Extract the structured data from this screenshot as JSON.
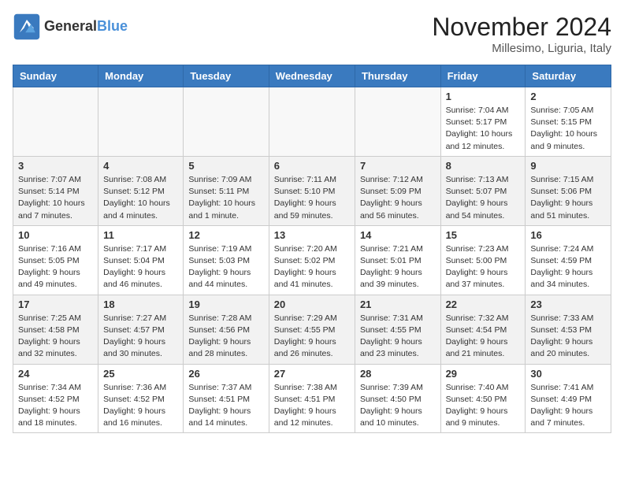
{
  "header": {
    "logo_line1": "General",
    "logo_line2": "Blue",
    "month": "November 2024",
    "location": "Millesimo, Liguria, Italy"
  },
  "weekdays": [
    "Sunday",
    "Monday",
    "Tuesday",
    "Wednesday",
    "Thursday",
    "Friday",
    "Saturday"
  ],
  "weeks": [
    [
      {
        "day": "",
        "info": ""
      },
      {
        "day": "",
        "info": ""
      },
      {
        "day": "",
        "info": ""
      },
      {
        "day": "",
        "info": ""
      },
      {
        "day": "",
        "info": ""
      },
      {
        "day": "1",
        "info": "Sunrise: 7:04 AM\nSunset: 5:17 PM\nDaylight: 10 hours\nand 12 minutes."
      },
      {
        "day": "2",
        "info": "Sunrise: 7:05 AM\nSunset: 5:15 PM\nDaylight: 10 hours\nand 9 minutes."
      }
    ],
    [
      {
        "day": "3",
        "info": "Sunrise: 7:07 AM\nSunset: 5:14 PM\nDaylight: 10 hours\nand 7 minutes."
      },
      {
        "day": "4",
        "info": "Sunrise: 7:08 AM\nSunset: 5:12 PM\nDaylight: 10 hours\nand 4 minutes."
      },
      {
        "day": "5",
        "info": "Sunrise: 7:09 AM\nSunset: 5:11 PM\nDaylight: 10 hours\nand 1 minute."
      },
      {
        "day": "6",
        "info": "Sunrise: 7:11 AM\nSunset: 5:10 PM\nDaylight: 9 hours\nand 59 minutes."
      },
      {
        "day": "7",
        "info": "Sunrise: 7:12 AM\nSunset: 5:09 PM\nDaylight: 9 hours\nand 56 minutes."
      },
      {
        "day": "8",
        "info": "Sunrise: 7:13 AM\nSunset: 5:07 PM\nDaylight: 9 hours\nand 54 minutes."
      },
      {
        "day": "9",
        "info": "Sunrise: 7:15 AM\nSunset: 5:06 PM\nDaylight: 9 hours\nand 51 minutes."
      }
    ],
    [
      {
        "day": "10",
        "info": "Sunrise: 7:16 AM\nSunset: 5:05 PM\nDaylight: 9 hours\nand 49 minutes."
      },
      {
        "day": "11",
        "info": "Sunrise: 7:17 AM\nSunset: 5:04 PM\nDaylight: 9 hours\nand 46 minutes."
      },
      {
        "day": "12",
        "info": "Sunrise: 7:19 AM\nSunset: 5:03 PM\nDaylight: 9 hours\nand 44 minutes."
      },
      {
        "day": "13",
        "info": "Sunrise: 7:20 AM\nSunset: 5:02 PM\nDaylight: 9 hours\nand 41 minutes."
      },
      {
        "day": "14",
        "info": "Sunrise: 7:21 AM\nSunset: 5:01 PM\nDaylight: 9 hours\nand 39 minutes."
      },
      {
        "day": "15",
        "info": "Sunrise: 7:23 AM\nSunset: 5:00 PM\nDaylight: 9 hours\nand 37 minutes."
      },
      {
        "day": "16",
        "info": "Sunrise: 7:24 AM\nSunset: 4:59 PM\nDaylight: 9 hours\nand 34 minutes."
      }
    ],
    [
      {
        "day": "17",
        "info": "Sunrise: 7:25 AM\nSunset: 4:58 PM\nDaylight: 9 hours\nand 32 minutes."
      },
      {
        "day": "18",
        "info": "Sunrise: 7:27 AM\nSunset: 4:57 PM\nDaylight: 9 hours\nand 30 minutes."
      },
      {
        "day": "19",
        "info": "Sunrise: 7:28 AM\nSunset: 4:56 PM\nDaylight: 9 hours\nand 28 minutes."
      },
      {
        "day": "20",
        "info": "Sunrise: 7:29 AM\nSunset: 4:55 PM\nDaylight: 9 hours\nand 26 minutes."
      },
      {
        "day": "21",
        "info": "Sunrise: 7:31 AM\nSunset: 4:55 PM\nDaylight: 9 hours\nand 23 minutes."
      },
      {
        "day": "22",
        "info": "Sunrise: 7:32 AM\nSunset: 4:54 PM\nDaylight: 9 hours\nand 21 minutes."
      },
      {
        "day": "23",
        "info": "Sunrise: 7:33 AM\nSunset: 4:53 PM\nDaylight: 9 hours\nand 20 minutes."
      }
    ],
    [
      {
        "day": "24",
        "info": "Sunrise: 7:34 AM\nSunset: 4:52 PM\nDaylight: 9 hours\nand 18 minutes."
      },
      {
        "day": "25",
        "info": "Sunrise: 7:36 AM\nSunset: 4:52 PM\nDaylight: 9 hours\nand 16 minutes."
      },
      {
        "day": "26",
        "info": "Sunrise: 7:37 AM\nSunset: 4:51 PM\nDaylight: 9 hours\nand 14 minutes."
      },
      {
        "day": "27",
        "info": "Sunrise: 7:38 AM\nSunset: 4:51 PM\nDaylight: 9 hours\nand 12 minutes."
      },
      {
        "day": "28",
        "info": "Sunrise: 7:39 AM\nSunset: 4:50 PM\nDaylight: 9 hours\nand 10 minutes."
      },
      {
        "day": "29",
        "info": "Sunrise: 7:40 AM\nSunset: 4:50 PM\nDaylight: 9 hours\nand 9 minutes."
      },
      {
        "day": "30",
        "info": "Sunrise: 7:41 AM\nSunset: 4:49 PM\nDaylight: 9 hours\nand 7 minutes."
      }
    ]
  ]
}
